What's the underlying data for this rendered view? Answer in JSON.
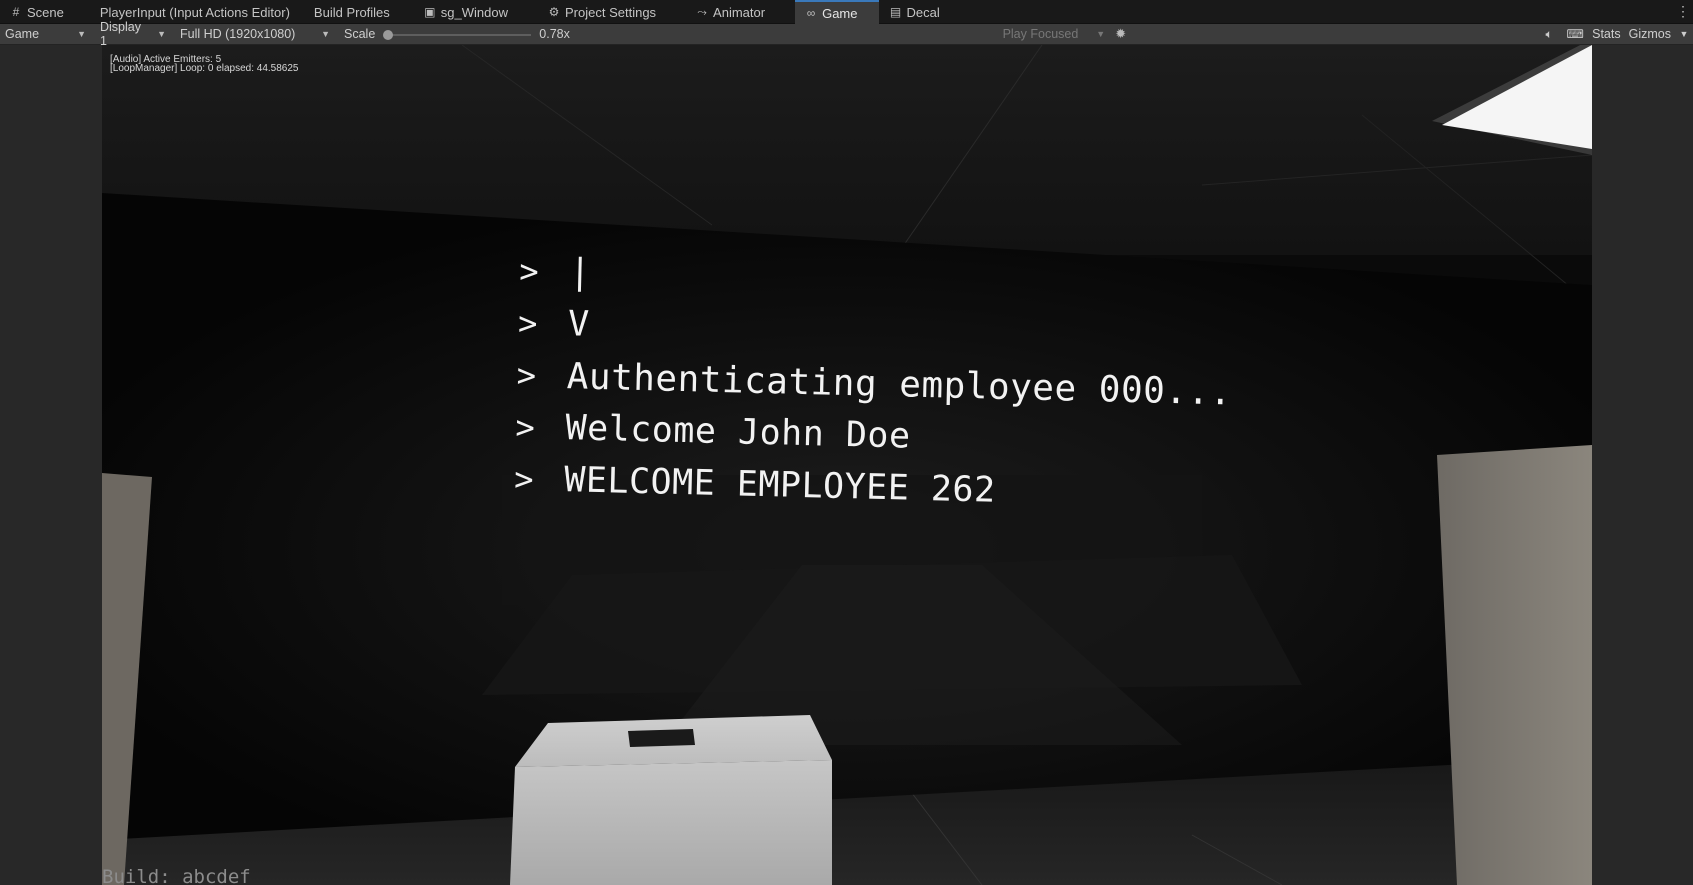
{
  "tabs": [
    {
      "label": "Scene",
      "icon": "grid-icon",
      "active": false
    },
    {
      "label": "PlayerInput (Input Actions Editor)",
      "icon": "",
      "active": false
    },
    {
      "label": "Build Profiles",
      "icon": "",
      "active": false
    },
    {
      "label": "sg_Window",
      "icon": "shader-graph-icon",
      "active": false
    },
    {
      "label": "Project Settings",
      "icon": "gear-icon",
      "active": false
    },
    {
      "label": "Animator",
      "icon": "animator-icon",
      "active": false
    },
    {
      "label": "Game",
      "icon": "gamepad-icon",
      "active": true
    },
    {
      "label": "Decal",
      "icon": "decal-icon",
      "active": false
    }
  ],
  "toolbar": {
    "view_mode": "Game",
    "display": "Display 1",
    "resolution": "Full HD (1920x1080)",
    "scale_label": "Scale",
    "scale_value": "0.78x",
    "play_mode": "Play Focused",
    "stats_label": "Stats",
    "gizmos_label": "Gizmos"
  },
  "game": {
    "debug_lines": [
      "[Audio] Active Emitters: 5",
      "[LoopManager] Loop: 0 elapsed: 44.58625"
    ],
    "terminal": {
      "prompt": ">",
      "lines": [
        "|",
        "V",
        "Authenticating employee 000...",
        "Welcome John Doe",
        "WELCOME EMPLOYEE 262"
      ]
    },
    "build_label": "Build: abcdef"
  },
  "colors": {
    "tab_bar_bg": "#191919",
    "toolbar_bg": "#3c3c3c",
    "active_tab_accent": "#3a79bb",
    "terminal_text": "#f2f2f2"
  }
}
